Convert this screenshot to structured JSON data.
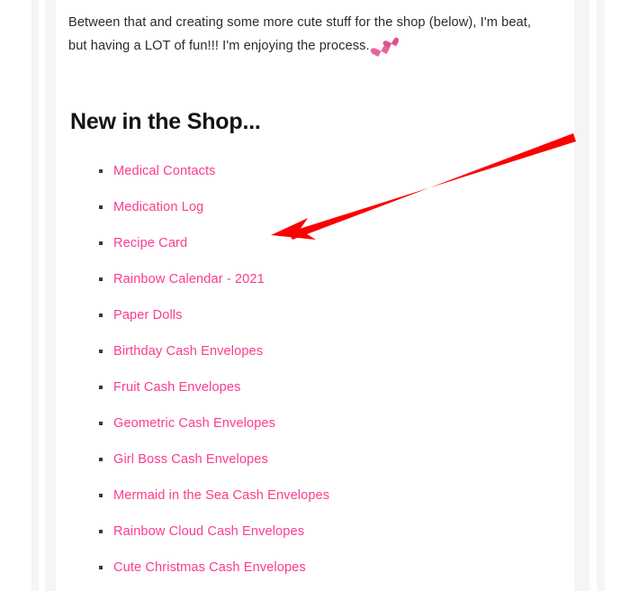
{
  "post": {
    "paragraph": "Between that and creating some more cute stuff for the shop (below), I'm beat, but having a LOT of fun!!! I'm enjoying the process.",
    "paragraph_emoji": "two-hearts-emoji",
    "heading": "New in the Shop...",
    "shop_items": [
      {
        "label": "Medical Contacts"
      },
      {
        "label": "Medication Log"
      },
      {
        "label": "Recipe Card"
      },
      {
        "label": "Rainbow Calendar - 2021"
      },
      {
        "label": "Paper Dolls"
      },
      {
        "label": "Birthday Cash Envelopes"
      },
      {
        "label": "Fruit Cash Envelopes"
      },
      {
        "label": "Geometric Cash Envelopes"
      },
      {
        "label": "Girl Boss Cash Envelopes"
      },
      {
        "label": "Mermaid in the Sea Cash Envelopes"
      },
      {
        "label": "Rainbow Cloud Cash Envelopes"
      },
      {
        "label": "Cute Christmas Cash Envelopes"
      }
    ]
  },
  "annotation": {
    "arrow_name": "red-pointer-arrow",
    "arrow_color": "#fb0000",
    "points_at": "Recipe Card"
  },
  "colors": {
    "link_pink": "#fb3c8d",
    "body_text": "#2b2b2b",
    "heading_text": "#141414",
    "gutter_gray": "#f5f5f6",
    "arrow_red": "#fb0000",
    "heart_pink": "#e8639f"
  }
}
